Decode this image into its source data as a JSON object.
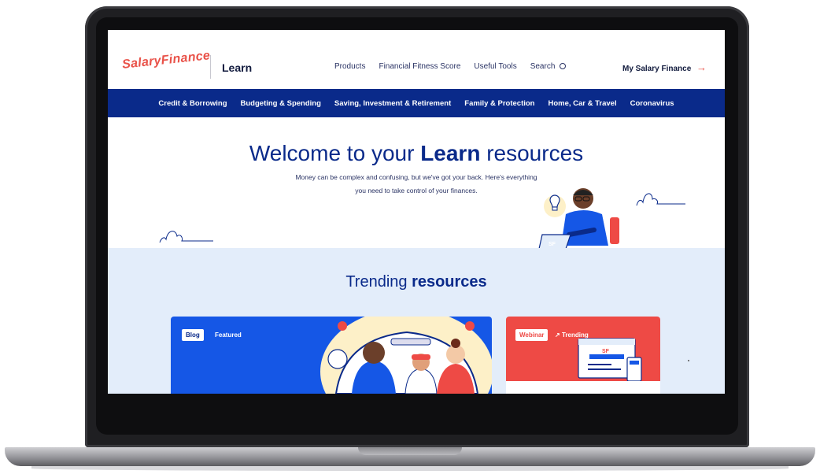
{
  "brand": {
    "logo_text": "SalaryFinance",
    "section_title": "Learn",
    "accent": "#e9534a",
    "primary": "#0a2a8a"
  },
  "topnav": {
    "items": [
      "Products",
      "Financial Fitness Score",
      "Useful Tools",
      "Search"
    ],
    "account_link": "My Salary Finance"
  },
  "categories": [
    "Credit & Borrowing",
    "Budgeting & Spending",
    "Saving, Investment & Retirement",
    "Family & Protection",
    "Home, Car & Travel",
    "Coronavirus"
  ],
  "hero": {
    "title_prefix": "Welcome to your ",
    "title_bold": "Learn",
    "title_suffix": " resources",
    "subtitle": "Money can be complex and confusing, but we've got your back. Here's everything you need to take control of your finances."
  },
  "trending": {
    "title_prefix": "Trending ",
    "title_bold": "resources",
    "cards": [
      {
        "tag": "Blog",
        "label": "Featured"
      },
      {
        "tag": "Webinar",
        "label": "Trending"
      }
    ]
  },
  "icons": {
    "search": "search-icon",
    "arrow": "arrow-right-icon",
    "trending": "trending-up-icon"
  }
}
